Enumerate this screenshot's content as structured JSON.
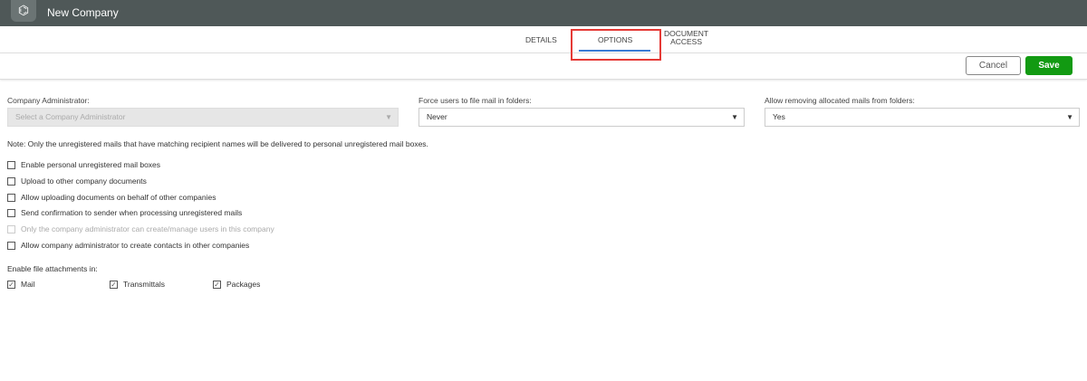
{
  "header": {
    "title": "New Company",
    "logo_icon": "company-logo"
  },
  "tabs": [
    {
      "label": "DETAILS"
    },
    {
      "label": "OPTIONS",
      "active": true
    },
    {
      "label": "DOCUMENT ACCESS",
      "line1": "DOCUMENT",
      "line2": "ACCESS"
    }
  ],
  "toolbar": {
    "cancel_label": "Cancel",
    "save_label": "Save",
    "save_color": "#129a12"
  },
  "fields": {
    "admin": {
      "label": "Company Administrator:",
      "placeholder": "Select a Company Administrator"
    },
    "force": {
      "label": "Force users to file mail in folders:",
      "value": "Never"
    },
    "remove": {
      "label": "Allow removing allocated mails from folders:",
      "value": "Yes"
    }
  },
  "note": "Note: Only the unregistered mails that have matching recipient names will be delivered to personal unregistered mail boxes.",
  "options": [
    {
      "label": "Enable personal unregistered mail boxes",
      "checked": false
    },
    {
      "label": "Upload to other company documents",
      "checked": false
    },
    {
      "label": "Allow uploading documents on behalf of other companies",
      "checked": false
    },
    {
      "label": "Send confirmation to sender when processing unregistered mails",
      "checked": false
    },
    {
      "label": "Only the company administrator can create/manage users in this company",
      "checked": false,
      "disabled": true
    },
    {
      "label": "Allow company administrator to create contacts in other companies",
      "checked": false
    }
  ],
  "attachments": {
    "label": "Enable file attachments in:",
    "items": [
      {
        "label": "Mail",
        "checked": true
      },
      {
        "label": "Transmittals",
        "checked": true
      },
      {
        "label": "Packages",
        "checked": true
      }
    ]
  }
}
